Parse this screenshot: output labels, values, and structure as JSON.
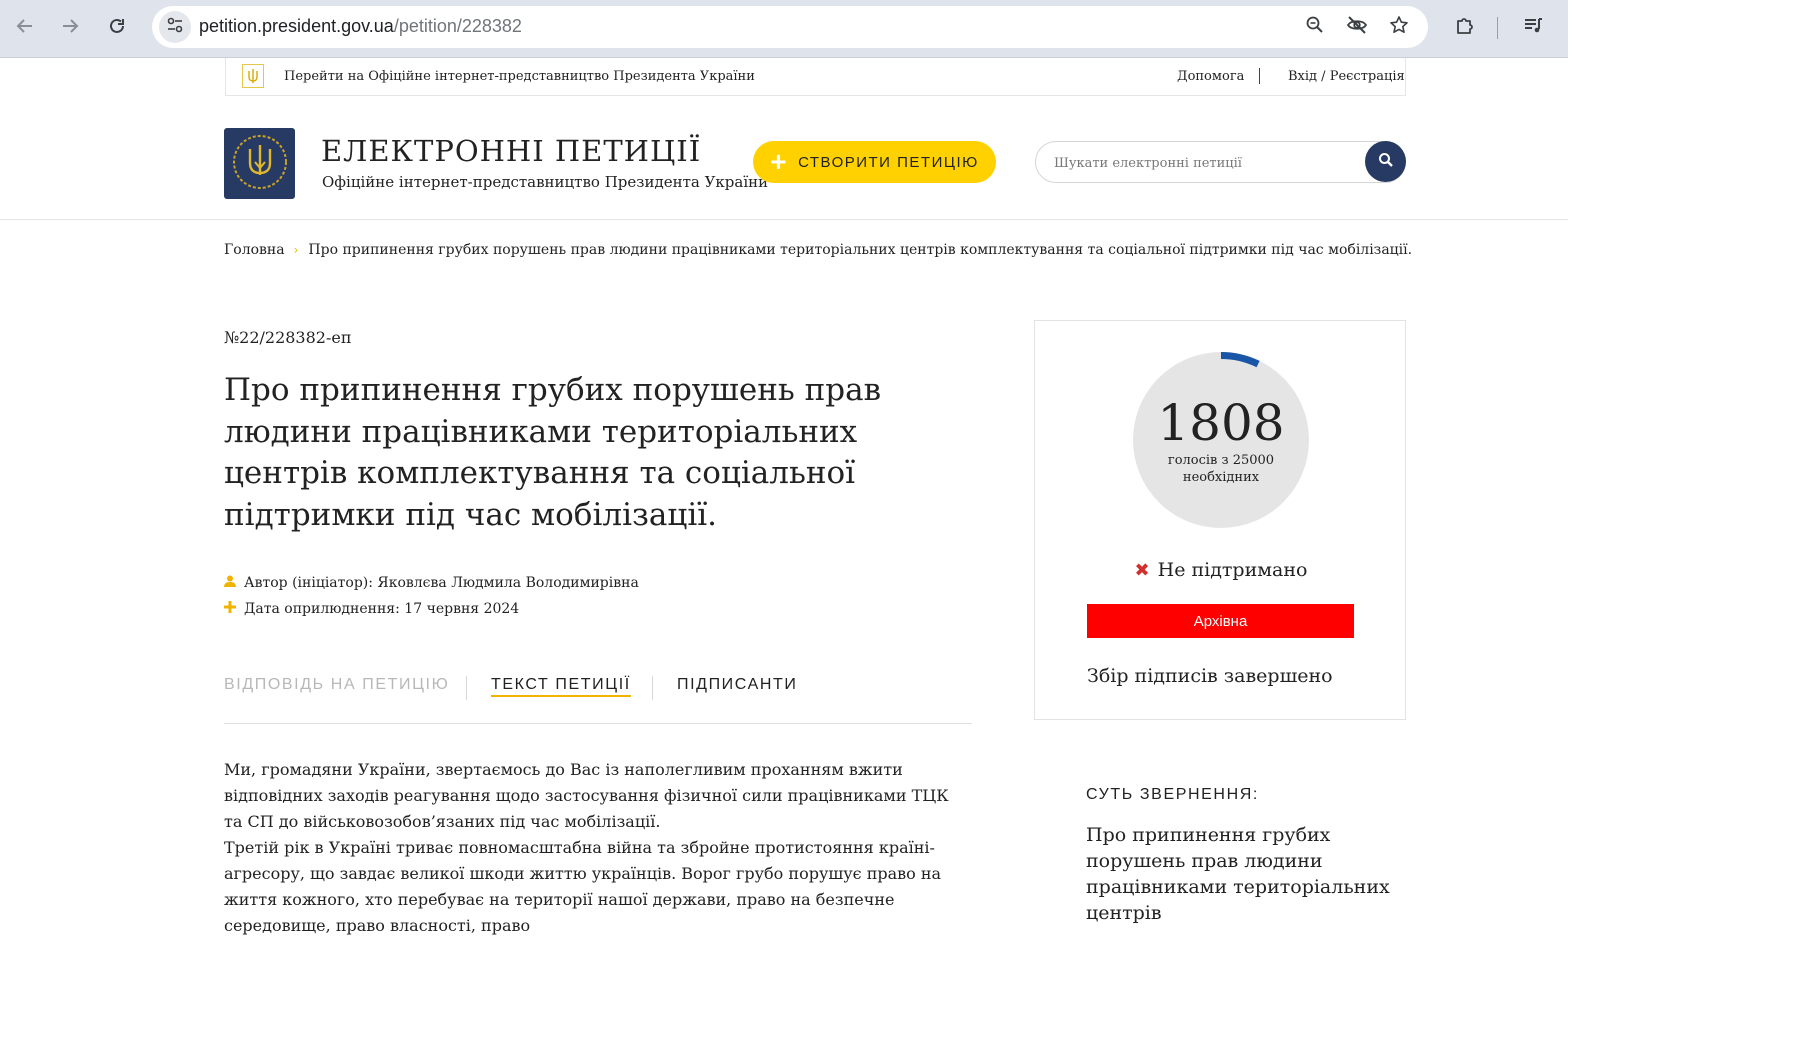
{
  "browser": {
    "url_host": "petition.president.gov.ua",
    "url_path": "/petition/228382"
  },
  "topbar": {
    "official_link": "Перейти на Офіційне інтернет-представництво Президента України",
    "help": "Допомога",
    "login": "Вхід / Реєстрація"
  },
  "header": {
    "title": "ЕЛЕКТРОННІ ПЕТИЦІЇ",
    "subtitle": "Офіційне інтернет-представництво Президента України",
    "create_button": "СТВОРИТИ ПЕТИЦІЮ",
    "search_placeholder": "Шукати електронні петиції"
  },
  "breadcrumb": {
    "home": "Головна",
    "current": "Про припинення грубих порушень прав людини працівниками територіальних центрів комплектування та соціальної підтримки під час мобілізації."
  },
  "petition": {
    "number": "№22/228382-еп",
    "title": "Про припинення грубих порушень прав людини працівниками територіальних центрів комплектування та соціальної підтримки під час мобілізації.",
    "author": "Автор (ініціатор): Яковлєва Людмила Володимирівна",
    "published": "Дата оприлюднення: 17 червня 2024"
  },
  "tabs": [
    {
      "label": "ВІДПОВІДЬ НА ПЕТИЦІЮ",
      "state": "disabled"
    },
    {
      "label": "ТЕКСТ ПЕТИЦІЇ",
      "state": "active"
    },
    {
      "label": "ПІДПИСАНТИ",
      "state": "normal"
    }
  ],
  "body": {
    "paragraph_1": "Ми, громадяни України, звертаємось до Вас із наполегливим проханням вжити відповідних заходів реагування щодо застосування фізичної сили працівниками ТЦК та СП до військовозобов’язаних під час мобілізації.",
    "paragraph_2": "Третій рік в Україні триває повномасштабна війна та збройне протистояння країні-агресору, що завдає великої шкоди життю українців. Ворог грубо порушує право на життя кожного, хто перебуває на території нашої держави, право на безпечне середовище, право власності, право"
  },
  "votes": {
    "count": "1808",
    "caption_line1": "голосів з 25000",
    "caption_line2": "необхідних",
    "collected": 1808,
    "required": 25000,
    "status": "Не підтримано",
    "archive_label": "Архівна",
    "collection_status": "Збір підписів завершено"
  },
  "essence": {
    "heading": "СУТЬ ЗВЕРНЕННЯ:",
    "text": "Про припинення грубих порушень прав людини працівниками територіальних центрів"
  },
  "colors": {
    "accent_yellow": "#ffd100",
    "brand_navy": "#273a63",
    "progress_blue": "#1a56a8",
    "archive_red": "#ff0000",
    "status_red": "#d32f2f"
  },
  "icons": {
    "back": "arrow-left-icon",
    "forward": "arrow-right-icon",
    "reload": "reload-icon",
    "site_info": "tune-icon",
    "zoom": "zoom-icon",
    "eye_off": "eye-off-icon",
    "bookmark": "star-icon",
    "extensions": "puzzle-icon",
    "reading_list": "queue-music-icon",
    "search": "search-icon",
    "author": "user-icon",
    "date": "plus-icon",
    "not_supported": "cross-icon"
  }
}
